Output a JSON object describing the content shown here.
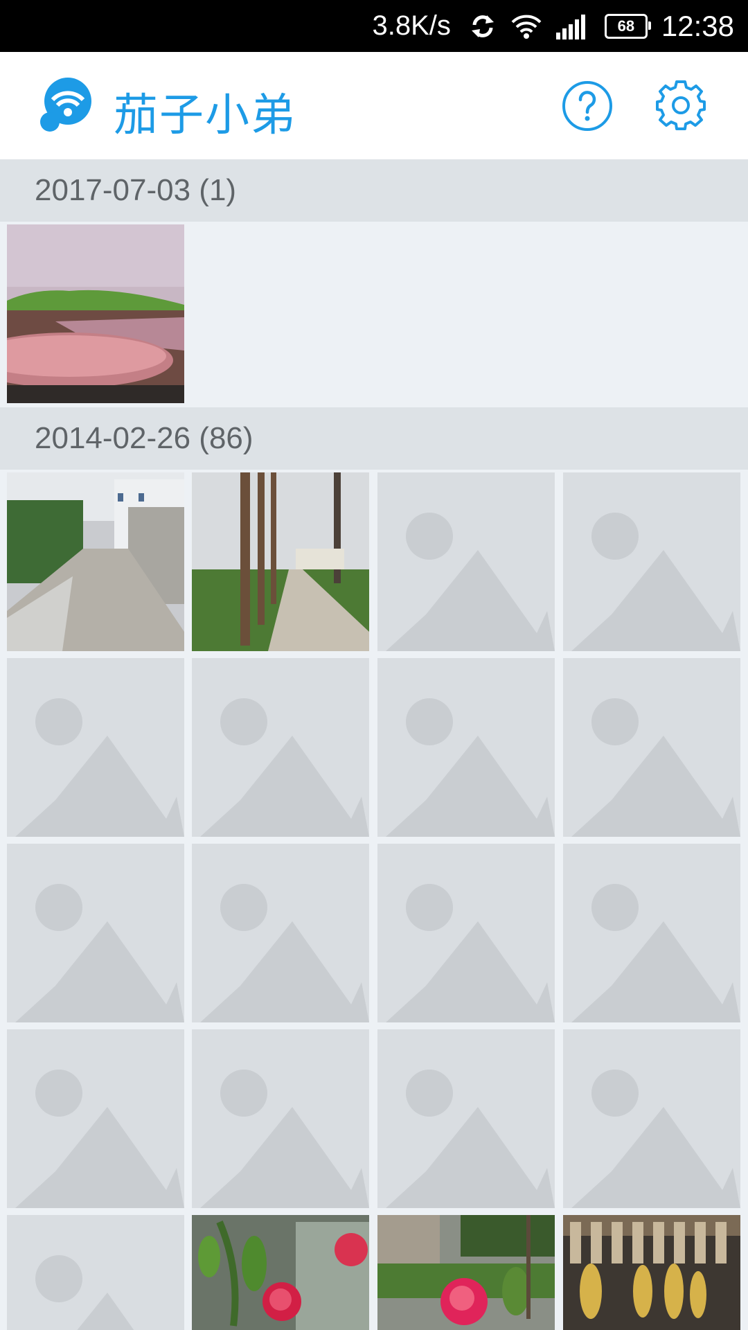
{
  "status_bar": {
    "network_speed": "3.8K/s",
    "battery_level": "68",
    "time": "12:38",
    "icons": [
      "sync-icon",
      "wifi-icon",
      "signal-icon",
      "battery-icon"
    ]
  },
  "app_bar": {
    "title": "茄子小弟",
    "logo_icon": "wifi-bubble-logo-icon",
    "help_icon": "help-icon",
    "settings_icon": "gear-icon"
  },
  "colors": {
    "accent": "#1d9be6",
    "section_bg": "#dde2e6",
    "page_bg": "#edf1f5",
    "placeholder_bg": "#d9dde1",
    "placeholder_shape": "#c9cdd1"
  },
  "sections": [
    {
      "header": "2017-07-03 (1)",
      "photos": [
        {
          "kind": "photo",
          "subject": "pink tabletop with green cloth"
        }
      ]
    },
    {
      "header": "2014-02-26 (86)",
      "photos": [
        {
          "kind": "photo",
          "subject": "village alley with houses"
        },
        {
          "kind": "photo",
          "subject": "tree-lined path"
        },
        {
          "kind": "placeholder"
        },
        {
          "kind": "placeholder"
        },
        {
          "kind": "placeholder"
        },
        {
          "kind": "placeholder"
        },
        {
          "kind": "placeholder"
        },
        {
          "kind": "placeholder"
        },
        {
          "kind": "placeholder"
        },
        {
          "kind": "placeholder"
        },
        {
          "kind": "placeholder"
        },
        {
          "kind": "placeholder"
        },
        {
          "kind": "placeholder"
        },
        {
          "kind": "placeholder"
        },
        {
          "kind": "placeholder"
        },
        {
          "kind": "placeholder"
        },
        {
          "kind": "placeholder"
        },
        {
          "kind": "photo",
          "subject": "red camellia flower"
        },
        {
          "kind": "photo",
          "subject": "pink camellia flower"
        },
        {
          "kind": "photo",
          "subject": "drying produce under roof"
        }
      ]
    }
  ]
}
